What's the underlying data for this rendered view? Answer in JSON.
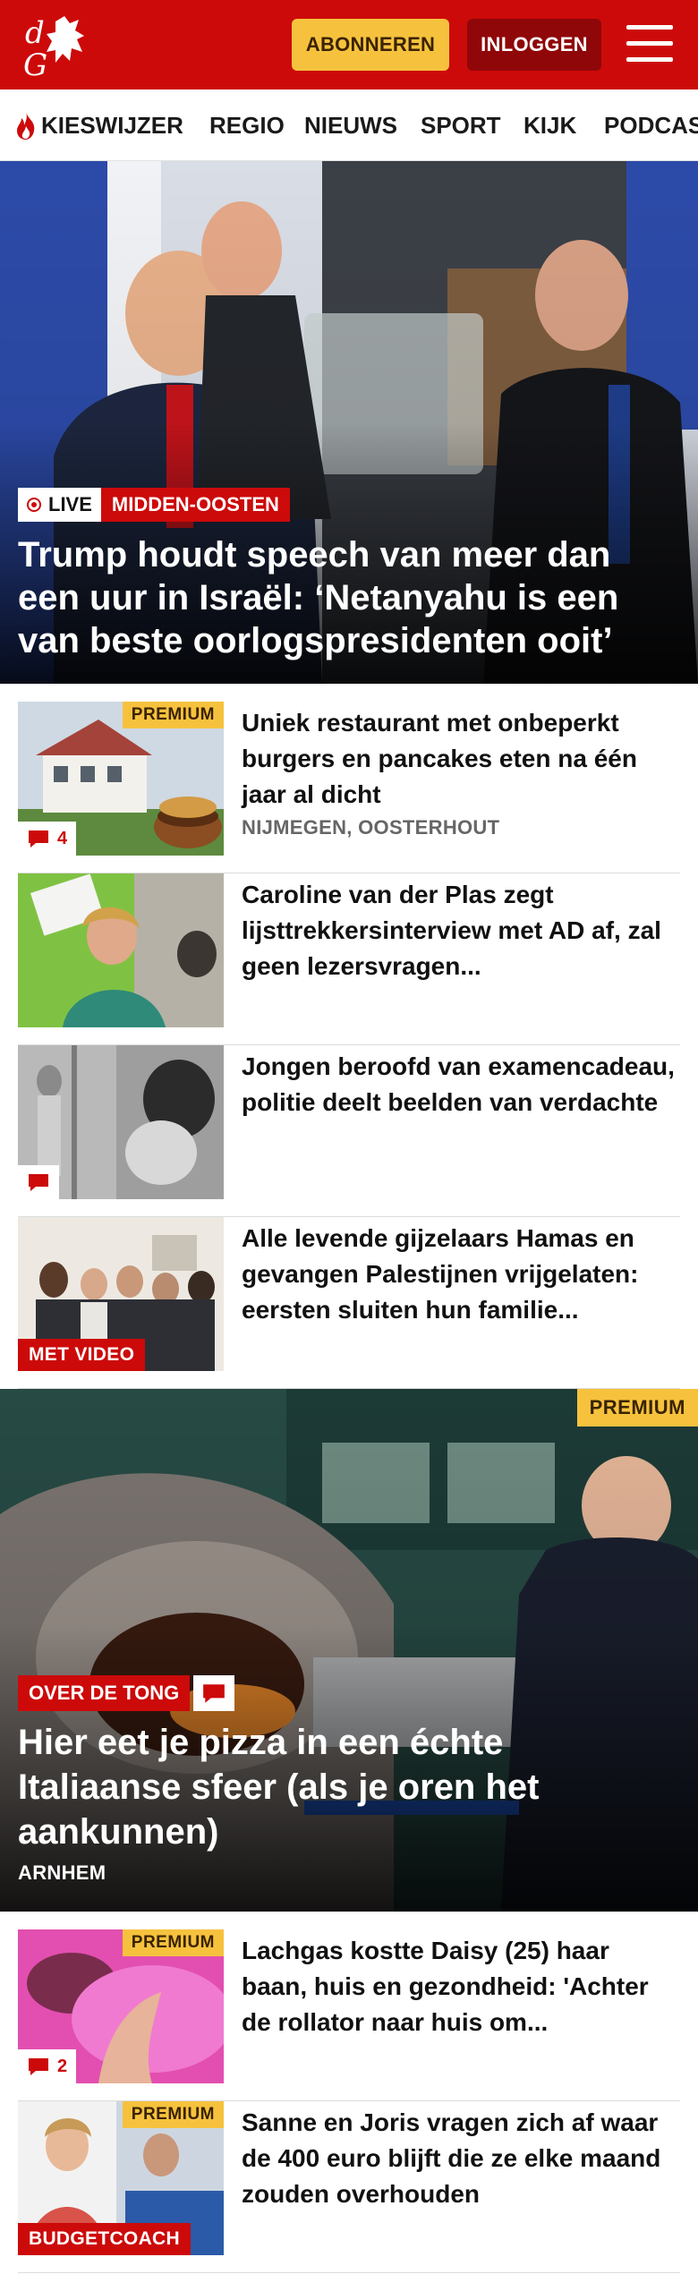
{
  "header": {
    "subscribe_label": "ABONNEREN",
    "login_label": "INLOGGEN",
    "brand_color": "#cc0a0a",
    "accent_color": "#f6c23e"
  },
  "nav": {
    "items": [
      {
        "label": "KIESWIJZER",
        "icon": "flame-icon"
      },
      {
        "label": "REGIO"
      },
      {
        "label": "NIEUWS"
      },
      {
        "label": "SPORT"
      },
      {
        "label": "KIJK"
      },
      {
        "label": "PODCAS"
      }
    ]
  },
  "hero": {
    "live_label": "LIVE",
    "category": "MIDDEN-OOSTEN",
    "title": "Trump houdt speech van meer dan een uur in Israël: ‘Netanyahu is een van beste oorlogspresidenten ooit’"
  },
  "articles": [
    {
      "title": "Uniek restaurant met onbeperkt burgers en pancakes eten na één jaar al dicht",
      "location": "NIJMEGEN, OOSTERHOUT",
      "premium": "PREMIUM",
      "comments": "4"
    },
    {
      "title": "Caroline van der Plas zegt lijsttrekkersinterview met AD af, zal geen lezersvragen..."
    },
    {
      "title": "Jongen beroofd van examenca­deau, politie deelt beelden van verdachte",
      "comments": ""
    },
    {
      "title": "Alle levende gijzelaars Hamas en gevangen Palestijnen vrijgela­ten: eersten sluiten hun familie...",
      "tag": "MET VIDEO"
    }
  ],
  "feature": {
    "premium": "PREMIUM",
    "tag": "OVER DE TONG",
    "title": "Hier eet je pizza in een échte Italiaanse sfeer (als je oren het aankunnen)",
    "location": "ARNHEM"
  },
  "articles2": [
    {
      "title": "Lachgas kostte Daisy (25) haar baan, huis en gezondheid: 'Achter de rollator naar huis om...",
      "premium": "PREMIUM",
      "comments": "2"
    },
    {
      "title": "Sanne en Joris vragen zich af waar de 400 euro blijft die ze elke maand zouden overhouden",
      "premium": "PREMIUM",
      "tag": "BUDGETCOACH"
    }
  ]
}
